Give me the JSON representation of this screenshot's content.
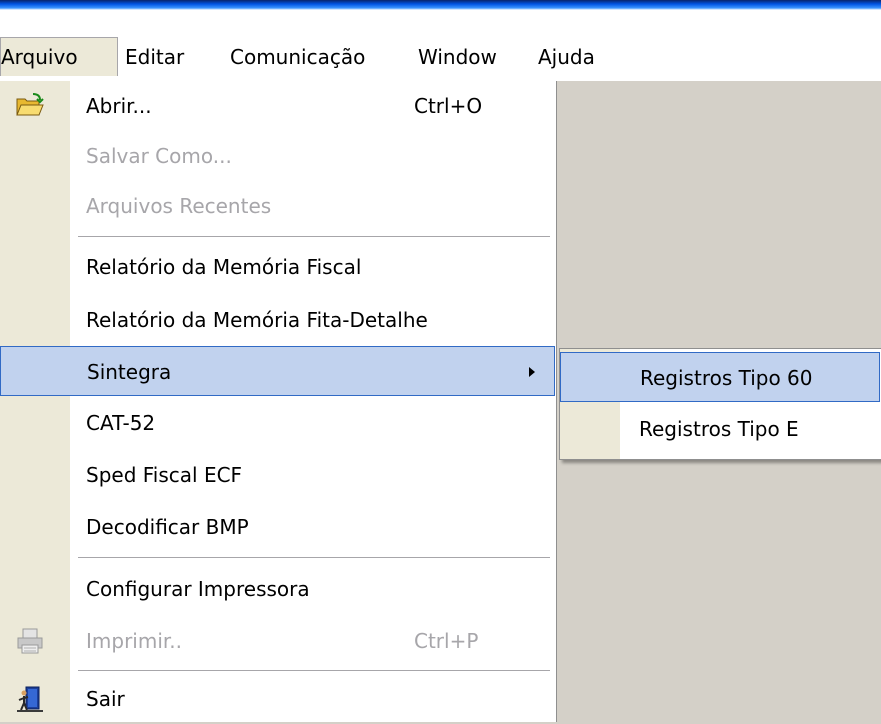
{
  "menubar": {
    "items": [
      {
        "label": "Arquivo"
      },
      {
        "label": "Editar"
      },
      {
        "label": "Comunicação"
      },
      {
        "label": "Window"
      },
      {
        "label": "Ajuda"
      }
    ]
  },
  "file_menu": {
    "open": {
      "label": "Abrir...",
      "shortcut": "Ctrl+O",
      "icon": "folder-open-icon"
    },
    "save_as": {
      "label": "Salvar Como..."
    },
    "recent": {
      "label": "Arquivos Recentes"
    },
    "fiscal_report": {
      "label": "Relatório da Memória Fiscal"
    },
    "tape_report": {
      "label": "Relatório da Memória Fita-Detalhe"
    },
    "sintegra": {
      "label": "Sintegra"
    },
    "cat52": {
      "label": "CAT-52"
    },
    "sped": {
      "label": "Sped Fiscal ECF"
    },
    "bmp": {
      "label": "Decodificar BMP"
    },
    "printer_setup": {
      "label": "Configurar Impressora"
    },
    "print": {
      "label": "Imprimir..",
      "shortcut": "Ctrl+P",
      "icon": "printer-icon"
    },
    "exit": {
      "label": "Sair",
      "icon": "exit-door-icon"
    }
  },
  "sintegra_submenu": {
    "items": [
      {
        "label": "Registros Tipo 60"
      },
      {
        "label": "Registros Tipo E"
      }
    ]
  },
  "colors": {
    "highlight": "#c1d2ee",
    "highlight_border": "#316ac5",
    "gutter": "#ece9d8",
    "disabled_text": "#a7a6aa",
    "workspace": "#d4d0c8"
  }
}
